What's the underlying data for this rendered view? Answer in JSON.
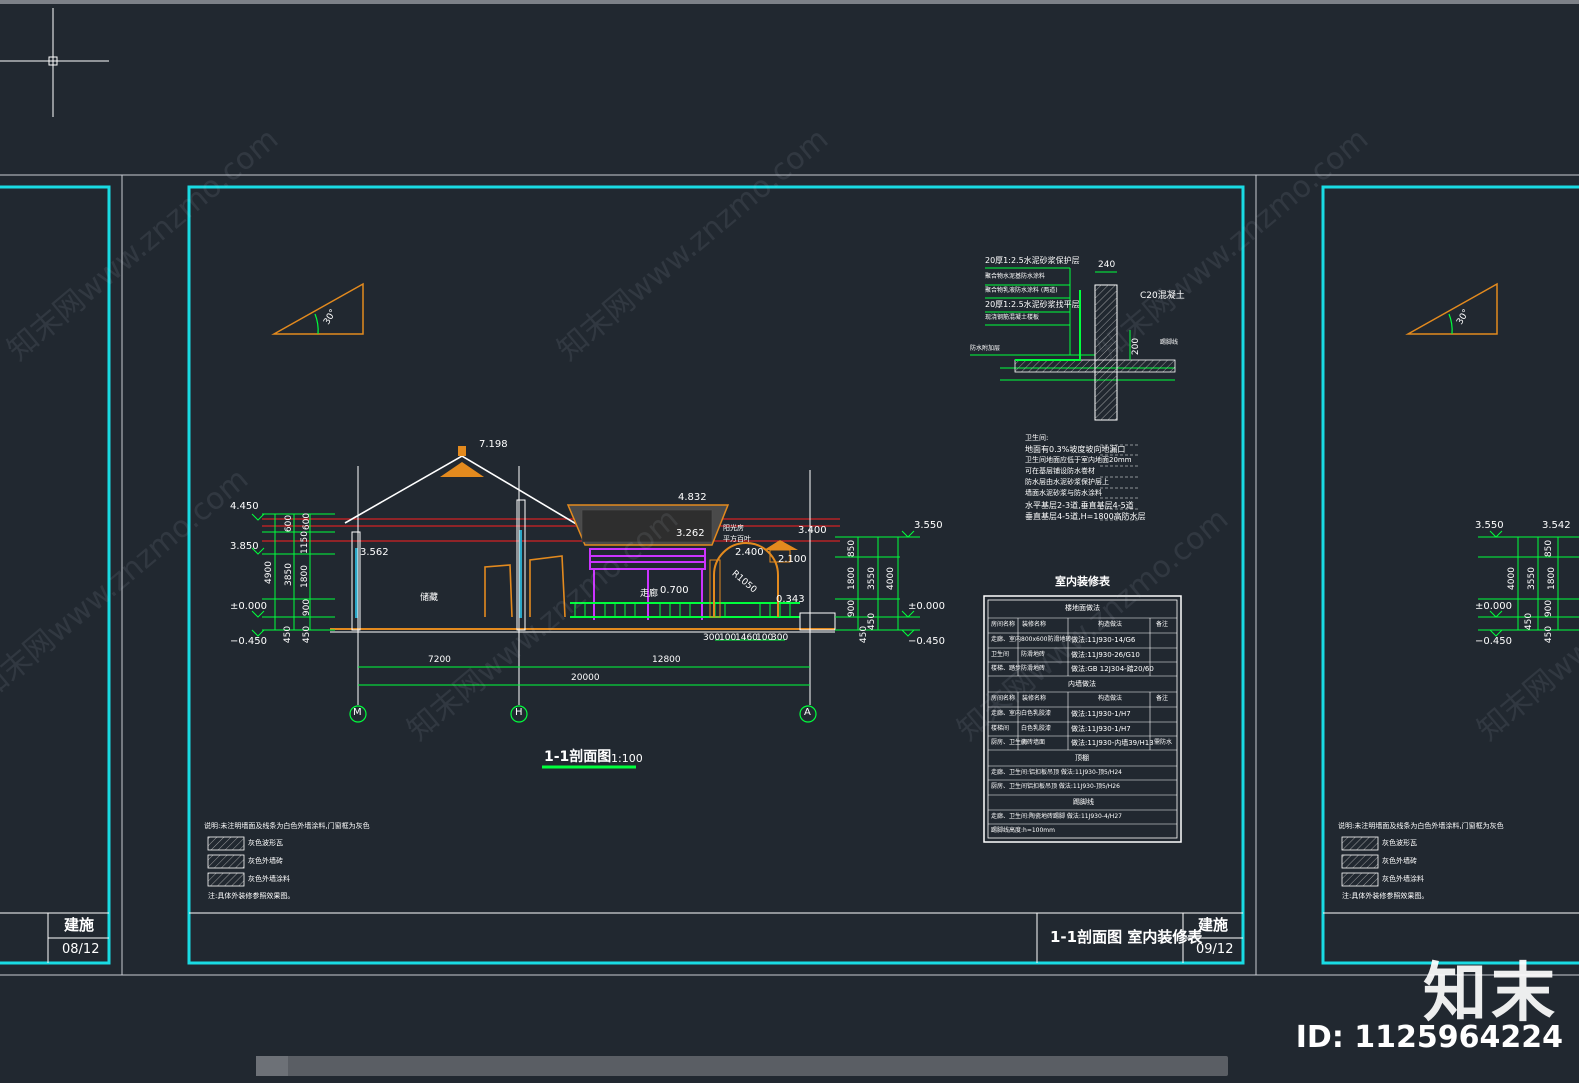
{
  "sheets": {
    "left": {
      "code": "建施",
      "page": "08/12"
    },
    "center": {
      "code": "建施",
      "page": "09/12",
      "title_block": "1-1剖面图  室内装修表"
    },
    "right": {}
  },
  "section_drawing": {
    "title": "1-1剖面图",
    "scale": "1:100",
    "elevations_left": [
      "4.450",
      "3.850",
      "±0.000",
      "−0.450"
    ],
    "elevations_right": [
      "3.550",
      "±0.000",
      "−0.450"
    ],
    "elevation_marks": [
      "7.198",
      "4.832",
      "3.262",
      "3.400",
      "2.400",
      "3.562",
      "2.100",
      "0.700",
      "0.343"
    ],
    "dims_left": [
      "600",
      "1150",
      "600",
      "4900",
      "3850",
      "1800",
      "900",
      "450",
      "450"
    ],
    "dims_right": [
      "850",
      "1800",
      "3550",
      "4000",
      "900",
      "450",
      "450"
    ],
    "bottom_dims": [
      "300",
      "100",
      "1460",
      "100",
      "300"
    ],
    "axis_dims": [
      "7200",
      "12800",
      "20000"
    ],
    "axes": [
      "M",
      "H",
      "A"
    ],
    "room_labels": [
      "储藏",
      "走廊"
    ],
    "annot_labels": [
      "阳光房",
      "平方百叶"
    ],
    "arc_label": "R1050",
    "angle_label": "30°"
  },
  "detail": {
    "notes": [
      "20厚1:2.5水泥砂浆保护层",
      "聚合物水泥基防水涂料",
      "聚合物乳液防水涂料 (两道)",
      "20厚1:2.5水泥砂浆找平层",
      "现浇钢筋混凝土楼板"
    ],
    "dims": [
      "240",
      "200"
    ],
    "labels": [
      "C20混凝土",
      "防水附加层",
      "踢脚线"
    ],
    "spec_title": "卫生间:",
    "spec_lines": [
      "地面有0.3%坡度坡向地漏口",
      "卫生间地面应低于室内地面20mm",
      "可在基层铺设防水卷材",
      "防水层由水泥砂浆保护层上",
      "墙面水泥砂浆与防水涂料",
      "水平基层2-3道,垂直基层4-5道",
      "垂直基层4-5道,H=1800高防水层"
    ]
  },
  "finish_table": {
    "title": "室内装修表",
    "section1": "楼地面做法",
    "col_headers": [
      "房间名称",
      "装修名称",
      "构造做法",
      "备注"
    ],
    "rows1": [
      [
        "走廊、室内",
        "800x600防滑地砖",
        "做法:11J930-14/G6",
        ""
      ],
      [
        "卫生间",
        "防滑地砖",
        "做法:11J930-26/G10",
        ""
      ],
      [
        "楼梯、踏步",
        "防滑地砖",
        "做法:GB 12J304-踏20/60",
        ""
      ]
    ],
    "section2": "内墙做法",
    "rows2": [
      [
        "走廊、室内",
        "白色乳胶漆",
        "做法:11J930-1/H7",
        ""
      ],
      [
        "楼梯间",
        "白色乳胶漆",
        "做法:11J930-1/H7",
        ""
      ],
      [
        "厨房、卫生间",
        "瓷砖墙面",
        "做法:11J930-内墙39/H13",
        "需防水"
      ]
    ],
    "section3": "顶棚",
    "ceiling": [
      "走廊、卫生间:铝扣板吊顶 做法:11J930-顶5/H24",
      "厨房、卫生间铝扣板吊顶 做法:11J930-顶5/H26"
    ],
    "section4": "踢脚线",
    "skirting": [
      "走廊、卫生间:陶瓷地砖踢脚 做法:11J930-4/H27",
      "踢脚线高度:h=100mm"
    ]
  },
  "legend": {
    "note": "说明:未注明墙面及线条为白色外墙涂料,门窗框为灰色",
    "items": [
      "灰色波形瓦",
      "灰色外墙砖",
      "灰色外墙涂料"
    ],
    "footer": "注:具体外装修参照效果图。"
  },
  "right_sheet": {
    "elevations": [
      "3.550",
      "±0.000",
      "−0.450"
    ],
    "mark": "3.542",
    "dims": [
      "850",
      "1800",
      "3550",
      "4000",
      "900",
      "450",
      "450"
    ]
  },
  "watermark": {
    "text": "知末网www.znzmo.com"
  },
  "brand": {
    "name": "知末",
    "id": "ID: 1125964224"
  },
  "colors": {
    "background": "#212830",
    "frame": "#19dbe3",
    "green": "#00ff3c",
    "orange": "#e38a1e",
    "red": "#ff2020",
    "magenta": "#cc33ff",
    "white": "#ffffff"
  }
}
